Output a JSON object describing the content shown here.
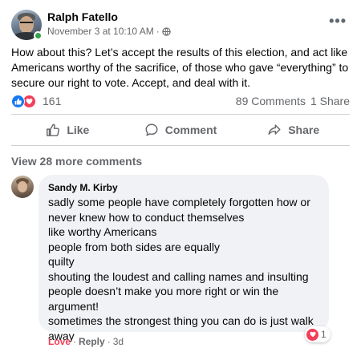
{
  "post": {
    "author": "Ralph Fatello",
    "date": "November 3 at 10:10 AM",
    "meta_separator": "·",
    "privacy_icon": "globe-icon",
    "more_label": "•••",
    "text": "How about this? Let’s accept the results of this election, and act like Americans worthy of the sacrifice, of those who gave “everything” to secure our right to vote. Accept, and deal with it."
  },
  "reactions": {
    "icons": [
      "like-icon",
      "love-icon"
    ],
    "count": "161",
    "comments": "89 Comments",
    "shares": "1 Share"
  },
  "actions": {
    "like": "Like",
    "comment": "Comment",
    "share": "Share"
  },
  "comments": {
    "view_more": "View 28 more comments",
    "items": [
      {
        "name": "Sandy M. Kirby",
        "lines": [
          "sadly some people have completely forgotten how or",
          "never knew how to conduct themselves",
          "like worthy Americans",
          "people from both sides are equally",
          "quilty",
          "shouting the loudest and calling names and insulting",
          "people doesn’t make you more right or win the",
          "argument!",
          "sometimes the strongest thing you can do is just walk",
          "away"
        ],
        "reaction_count": "1",
        "reaction_icon": "love-icon",
        "love_label": "Love",
        "reply_label": "Reply",
        "separator": "·",
        "time": "3d"
      }
    ]
  },
  "colors": {
    "like_blue": "#1877f2",
    "love_red": "#f33e58",
    "secondary_text": "#65676b",
    "online_green": "#31a24c"
  }
}
